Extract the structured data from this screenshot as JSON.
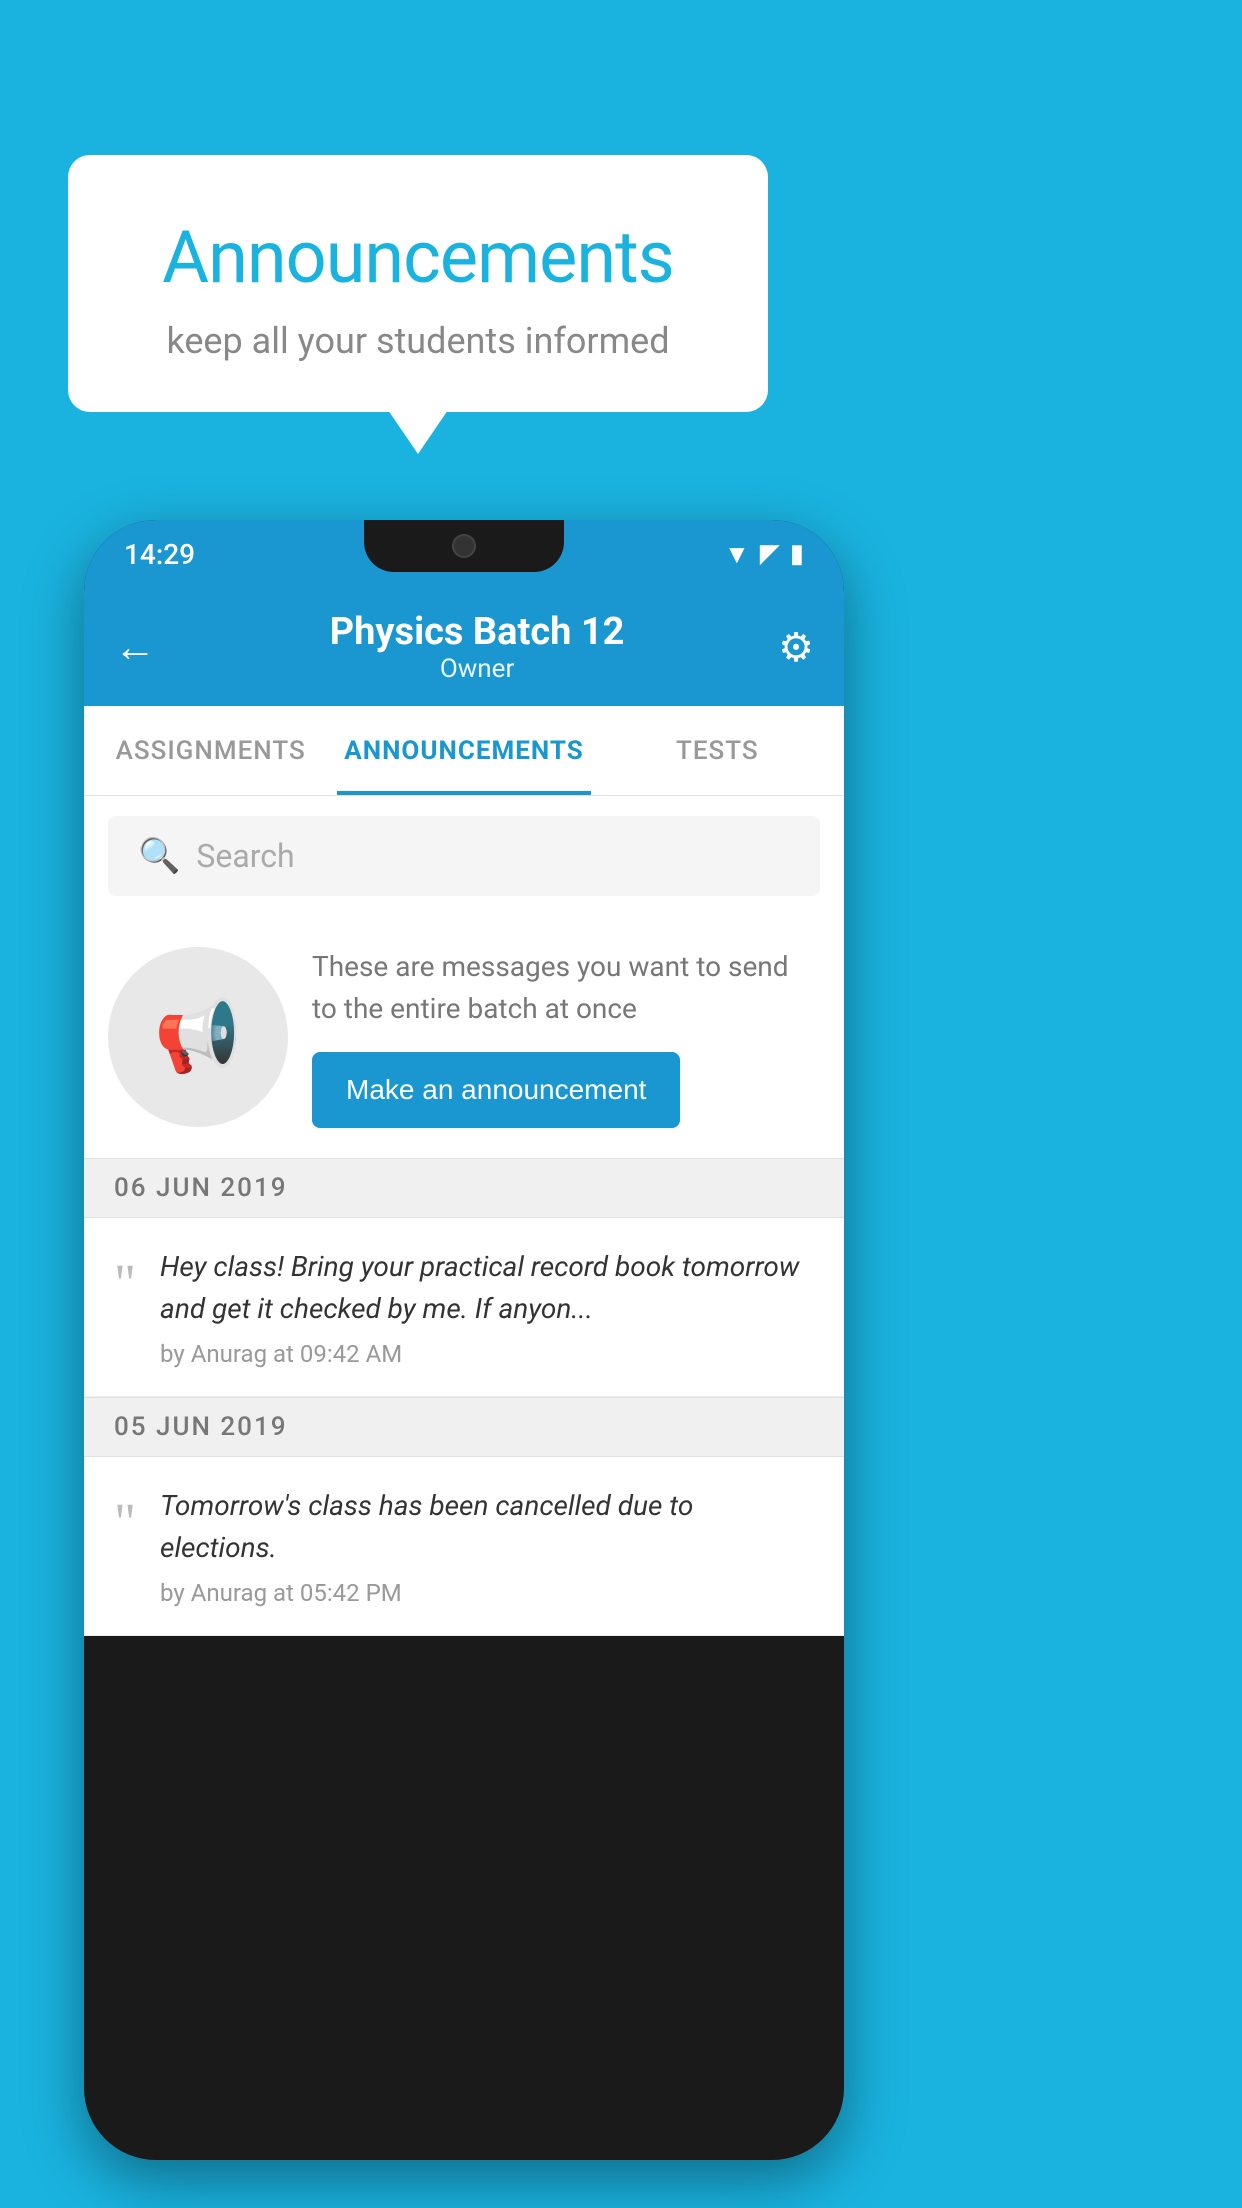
{
  "page": {
    "background_color": "#1ab3e0"
  },
  "speech_bubble": {
    "title": "Announcements",
    "subtitle": "keep all your students informed"
  },
  "status_bar": {
    "time": "14:29",
    "wifi": "▲",
    "signal": "▲",
    "battery": "▉"
  },
  "app_bar": {
    "title": "Physics Batch 12",
    "subtitle": "Owner",
    "back_label": "←",
    "gear_symbol": "⚙"
  },
  "tabs": [
    {
      "label": "ASSIGNMENTS",
      "active": false
    },
    {
      "label": "ANNOUNCEMENTS",
      "active": true
    },
    {
      "label": "TESTS",
      "active": false
    }
  ],
  "search": {
    "placeholder": "Search"
  },
  "promo": {
    "description": "These are messages you want to send to the entire batch at once",
    "button_label": "Make an announcement"
  },
  "announcements": [
    {
      "date": "06  JUN  2019",
      "text": "Hey class! Bring your practical record book tomorrow and get it checked by me. If anyon...",
      "meta": "by Anurag at 09:42 AM"
    },
    {
      "date": "05  JUN  2019",
      "text": "Tomorrow's class has been cancelled due to elections.",
      "meta": "by Anurag at 05:42 PM"
    }
  ]
}
